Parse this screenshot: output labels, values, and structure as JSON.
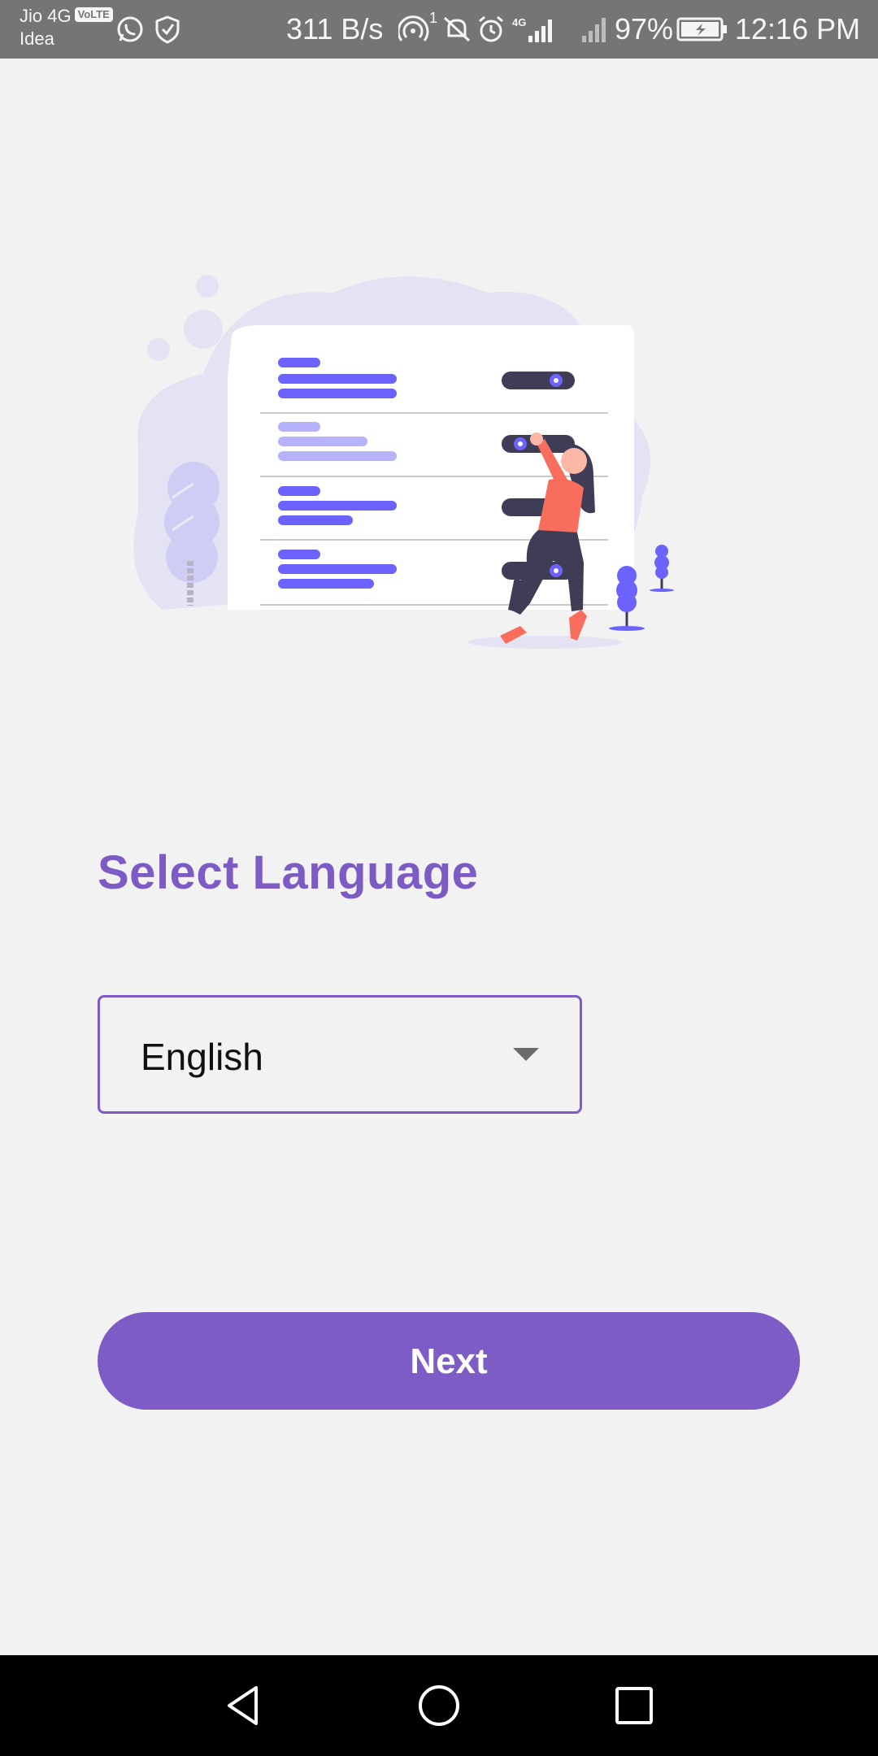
{
  "status_bar": {
    "carrier_line1": "Jio 4G",
    "volte_badge": "VoLTE",
    "carrier_line2": "Idea",
    "net_speed": "311 B/s",
    "hotspot_count": "1",
    "network_type": "4G",
    "battery_percent": "97%",
    "time": "12:16 PM",
    "icons": [
      "whatsapp-icon",
      "shield-icon",
      "hotspot-icon",
      "mute-icon",
      "alarm-icon",
      "signal-4g-icon",
      "signal-icon",
      "battery-charging-icon"
    ]
  },
  "main": {
    "title": "Select Language",
    "language_select": {
      "selected": "English"
    },
    "next_label": "Next"
  },
  "nav_bar": {
    "icons": [
      "back-icon",
      "home-icon",
      "recents-icon"
    ]
  },
  "colors": {
    "accent": "#7d5cc6",
    "title": "#7c5cc4",
    "illustration_primary": "#6c63ff",
    "illustration_person": "#f86d5c",
    "illustration_dark": "#3f3d56",
    "background": "#f2f2f2"
  }
}
